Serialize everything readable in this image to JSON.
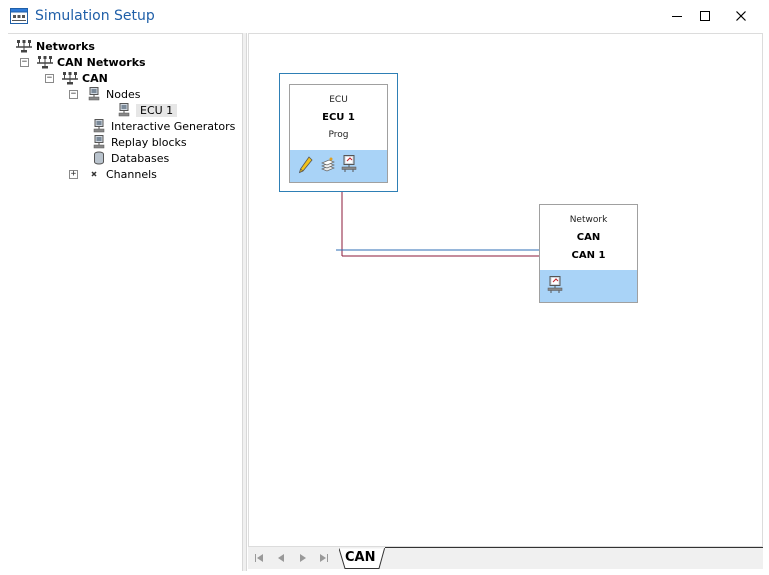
{
  "window": {
    "title": "Simulation Setup",
    "icon": "network-window-icon",
    "controls": [
      "minimize-icon",
      "maximize-icon",
      "close-icon"
    ]
  },
  "tree": {
    "networks": "Networks",
    "can_networks": "CAN Networks",
    "can": "CAN",
    "nodes": "Nodes",
    "ecu1": "ECU 1",
    "interactive_generators": "Interactive Generators",
    "replay_blocks": "Replay blocks",
    "databases": "Databases",
    "channels": "Channels",
    "expander_minus": "−",
    "expander_plus": "+"
  },
  "canvas": {
    "ecu_block": {
      "type": "ECU",
      "name": "ECU 1",
      "subtitle": "Prog",
      "icons": [
        "pencil-icon",
        "stack-icon",
        "node-config-icon"
      ]
    },
    "network_block": {
      "type": "Network",
      "name": "CAN",
      "channel": "CAN 1",
      "icons": [
        "node-config-icon"
      ]
    },
    "bus_colors": {
      "blue": "#2e6db4",
      "red": "#8b1a3a"
    },
    "selection_border": "#2e7fb5",
    "footer_color": "#a9d3f7"
  },
  "tabs": {
    "nav": [
      "first-icon",
      "prev-icon",
      "next-icon",
      "last-icon"
    ],
    "active": "CAN"
  }
}
